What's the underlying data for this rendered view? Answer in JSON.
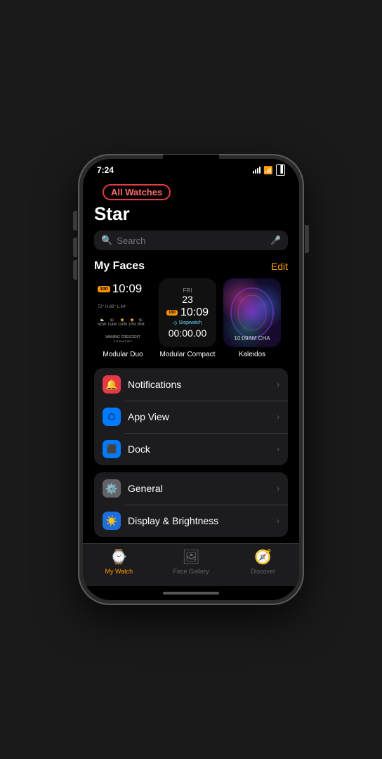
{
  "statusBar": {
    "time": "7:24",
    "locationIcon": "▶",
    "signalBars": [
      3,
      5,
      7,
      9
    ],
    "wifiIcon": "wifi",
    "batteryIcon": "battery"
  },
  "navigation": {
    "allWatchesLabel": "All Watches"
  },
  "pageTitle": "Star",
  "search": {
    "placeholder": "Search"
  },
  "myFaces": {
    "title": "My Faces",
    "editLabel": "Edit",
    "faces": [
      {
        "id": "modular-duo",
        "label": "Modular Duo",
        "time": "10:09",
        "badge": "100",
        "temp": "72° H:88° L:64°",
        "moonPhase": "Waning Crescent"
      },
      {
        "id": "modular-compact",
        "label": "Modular Compact",
        "dayOfWeek": "FRI",
        "date": "23",
        "time": "10:09",
        "badge": "100",
        "stopwatchLabel": "Stopwatch",
        "stopwatchTime": "00:00.00"
      },
      {
        "id": "kaleidoscope",
        "label": "Kaleidos",
        "timeDisplay": "10:09AM CHA"
      }
    ]
  },
  "menuSections": [
    {
      "id": "section1",
      "items": [
        {
          "id": "notifications",
          "icon": "🔔",
          "iconBg": "red",
          "label": "Notifications"
        },
        {
          "id": "app-view",
          "icon": "⬡",
          "iconBg": "blue-light",
          "label": "App View"
        },
        {
          "id": "dock",
          "icon": "⬛",
          "iconBg": "blue",
          "label": "Dock"
        }
      ]
    },
    {
      "id": "section2",
      "items": [
        {
          "id": "general",
          "icon": "⚙️",
          "iconBg": "gray",
          "label": "General"
        },
        {
          "id": "display-brightness",
          "icon": "☀️",
          "iconBg": "yellow",
          "label": "Display & Brightness"
        }
      ]
    }
  ],
  "tabBar": {
    "tabs": [
      {
        "id": "my-watch",
        "icon": "⌚",
        "label": "My Watch",
        "active": true
      },
      {
        "id": "face-gallery",
        "icon": "🖼",
        "label": "Face Gallery",
        "active": false
      },
      {
        "id": "discover",
        "icon": "🧭",
        "label": "Discover",
        "active": false
      }
    ]
  }
}
